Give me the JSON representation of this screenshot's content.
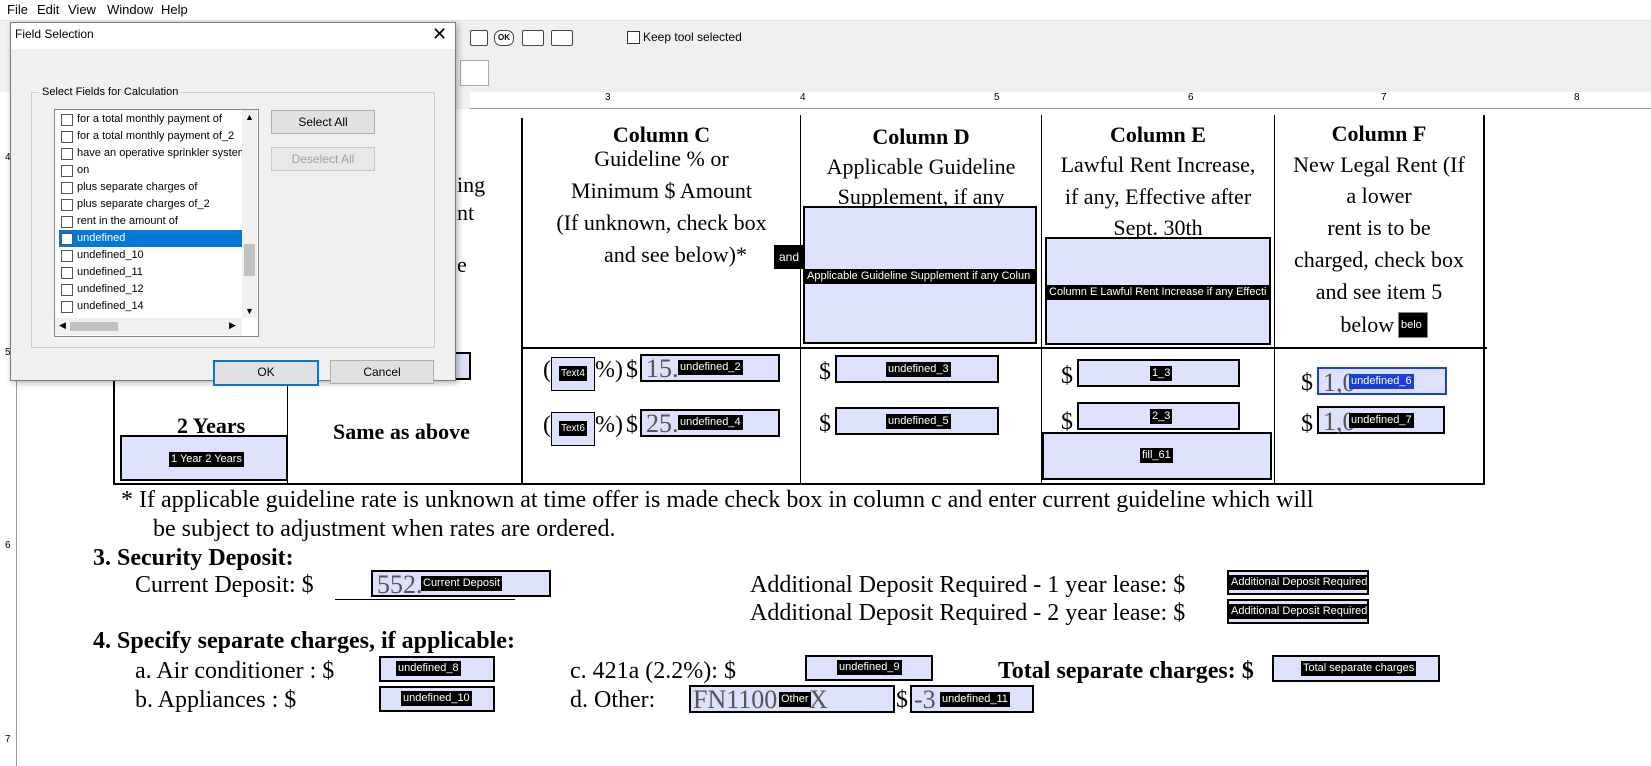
{
  "menu": [
    "File",
    "Edit",
    "View",
    "Window",
    "Help"
  ],
  "toolbar": {
    "ok_label": "OK",
    "keep_tool_label": "Keep tool selected"
  },
  "ruler": {
    "top": [
      "3",
      "4",
      "5",
      "6",
      "7",
      "8"
    ],
    "left": [
      "4",
      "5",
      "6",
      "7"
    ]
  },
  "dialog": {
    "title": "Field Selection",
    "group_label": "Select Fields for Calculation",
    "items": [
      "for a total monthly payment of",
      "for a total monthly payment of_2",
      "have an operative sprinkler system",
      "on",
      "plus separate charges of",
      "plus separate charges of_2",
      "rent in the amount of",
      "undefined",
      "undefined_10",
      "undefined_11",
      "undefined_12",
      "undefined_14"
    ],
    "selected_item": "undefined",
    "select_all": "Select All",
    "deselect_all": "Deselect All",
    "ok": "OK",
    "cancel": "Cancel"
  },
  "columns": {
    "partial_left": {
      "l1": "ing",
      "l2": "nt",
      "l3": "e"
    },
    "c": {
      "title": "Column  C",
      "l1": "Guideline % or",
      "l2": "Minimum $ Amount",
      "l3": "(If unknown, check box",
      "l4": "and see below)*",
      "field": "and"
    },
    "d": {
      "title": "Column  D",
      "l1": "Applicable Guideline",
      "l2": "Supplement, if any",
      "field": "Applicable Guideline Supplement if any Colun"
    },
    "e": {
      "title": "Column  E",
      "l1": "Lawful Rent Increase,",
      "l2": "if any, Effective after",
      "l3": "Sept. 30th",
      "field": "Column E Lawful Rent Increase if any Effecti"
    },
    "f": {
      "title": "Column  F",
      "l1": "New Legal Rent (If",
      "l2": "a  lower",
      "l3": "rent is to be",
      "l4": "charged, check box",
      "l5": "and see item 5",
      "l6": "below )",
      "field": "belo"
    }
  },
  "rows": {
    "years2": "2 Years",
    "same_as_above": "Same as above",
    "field_1y2y": "1 Year 2 Years",
    "pct_mark": "%)",
    "dollar": "$",
    "paren": "(",
    "text4": "Text4",
    "text6": "Text6",
    "under_c1": "15.",
    "under_c2": "25.",
    "under_f1": "1,0",
    "under_f2": "1,0",
    "c1_field": "undefined_2",
    "c2_field": "undefined_4",
    "d1_field": "undefined_3",
    "d2_field": "undefined_5",
    "e1_field": "1_3",
    "e2_field": "2_3",
    "e3_field": "fill_61",
    "f1_field": "undefined_6",
    "f2_field": "undefined_7"
  },
  "note": {
    "l1": "* If applicable guideline rate is unknown at time offer is made check box in column c and enter current guideline which will",
    "l2": "be subject to adjustment when rates are ordered."
  },
  "security": {
    "heading": "3.  Security Deposit:",
    "current_label": "Current Deposit:  $",
    "current_value": "552.",
    "current_field": "Current Deposit",
    "add1_label": "Additional Deposit Required - 1 year lease:   $",
    "add2_label": "Additional Deposit Required - 2 year lease:   $",
    "add1_field": "Additional Deposit Required",
    "add2_field": "Additional Deposit Required"
  },
  "charges": {
    "heading": "4.  Specify separate charges, if applicable:",
    "a_label": "a.  Air conditioner :   $",
    "b_label": "b.  Appliances      :  $",
    "c_label": "c.   421a (2.2%):     $",
    "d_label": "d.   Other:",
    "a_field": "undefined_8",
    "b_field": "undefined_10",
    "c_field": "undefined_9",
    "other_value": "FN1100",
    "other_suffix": "X",
    "other_field": "Other",
    "d_dollar": "$",
    "d_value": "-3",
    "d_field": "undefined_11",
    "total_label": "Total separate charges:  $",
    "total_field": "Total separate charges"
  }
}
